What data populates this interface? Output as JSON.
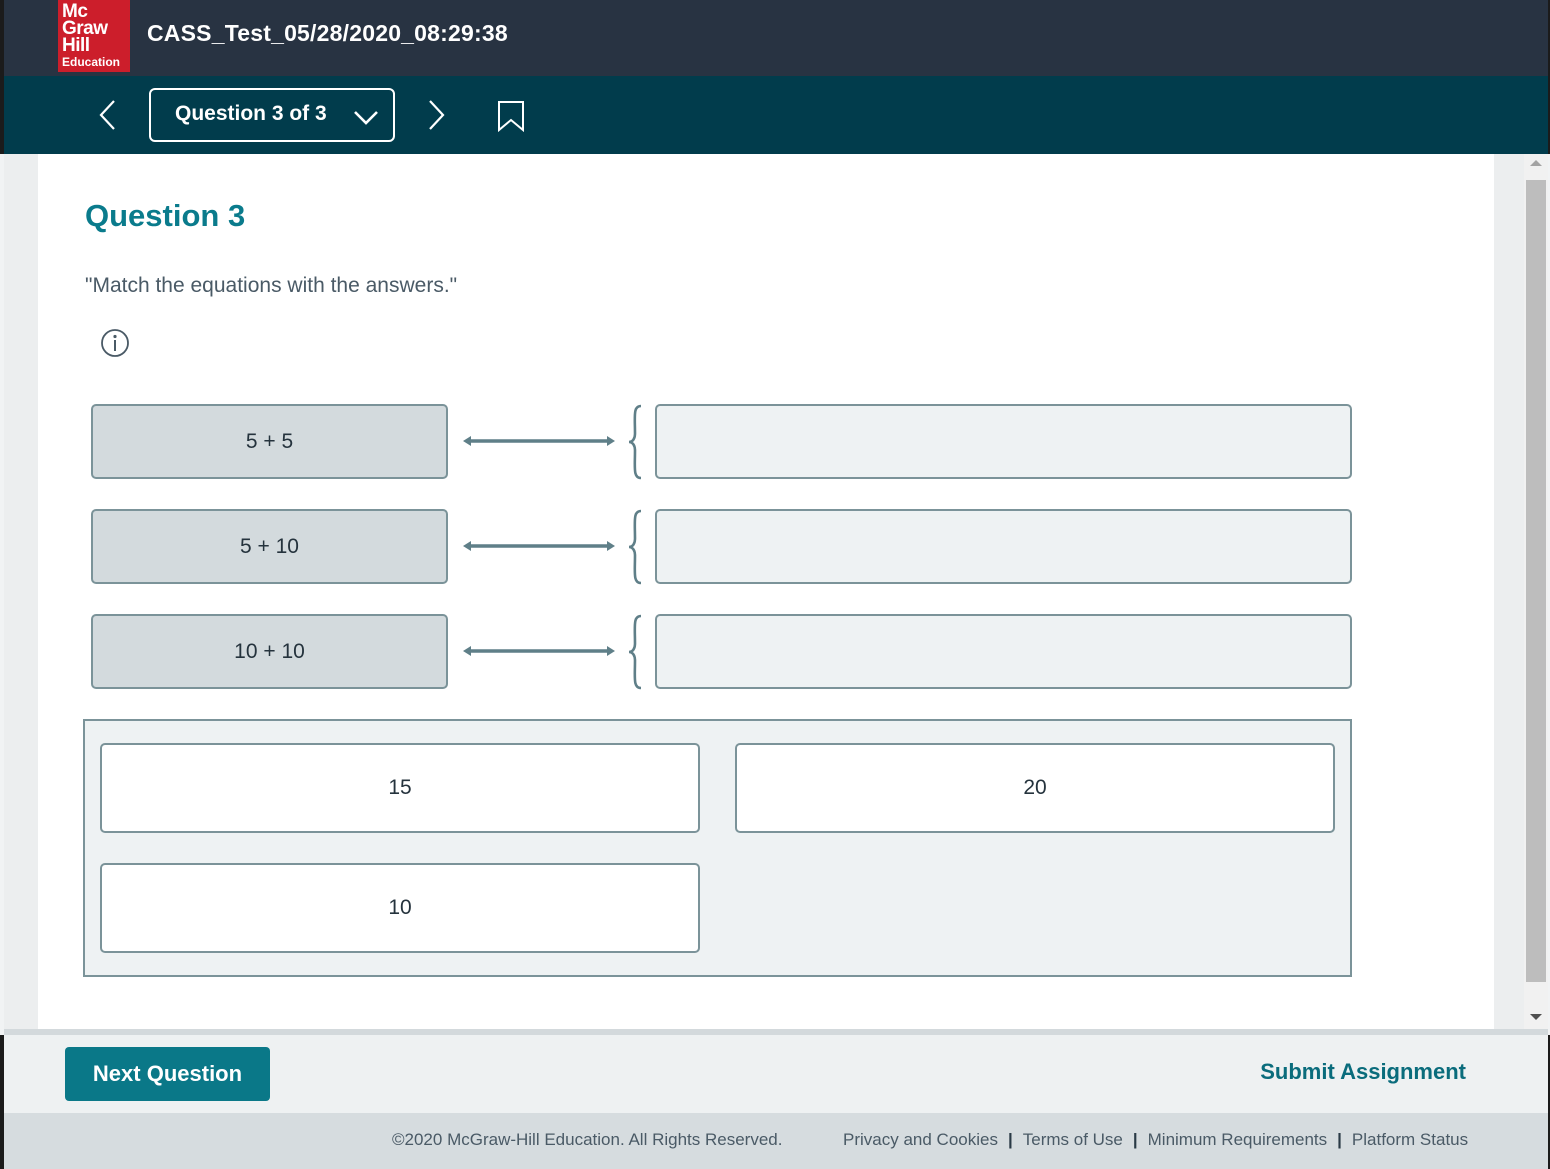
{
  "header": {
    "logo_lines": [
      "Mc",
      "Graw",
      "Hill",
      "Education"
    ],
    "title": "CASS_Test_05/28/2020_08:29:38"
  },
  "nav": {
    "question_selector": "Question 3 of 3",
    "icons": [
      "chevron-left-icon",
      "chevron-down-icon",
      "chevron-right-icon",
      "bookmark-icon"
    ]
  },
  "question": {
    "heading": "Question 3",
    "prompt": "\"Match the equations with the answers.\"",
    "info_icon": "info-icon",
    "pairs": [
      {
        "equation": "5 + 5",
        "answer": ""
      },
      {
        "equation": "5 + 10",
        "answer": ""
      },
      {
        "equation": "10 + 10",
        "answer": ""
      }
    ],
    "answer_bank": [
      "15",
      "20",
      "10"
    ]
  },
  "footer": {
    "next_label": "Next Question",
    "submit_label": "Submit Assignment",
    "copyright": "©2020 McGraw-Hill Education. All Rights Reserved.",
    "links": [
      "Privacy and Cookies",
      "Terms of Use",
      "Minimum Requirements",
      "Platform Status"
    ]
  },
  "colors": {
    "header_bg": "#283342",
    "nav_bg": "#013c4c",
    "accent": "#0a7b8c",
    "logo_red": "#cc1e2b"
  }
}
